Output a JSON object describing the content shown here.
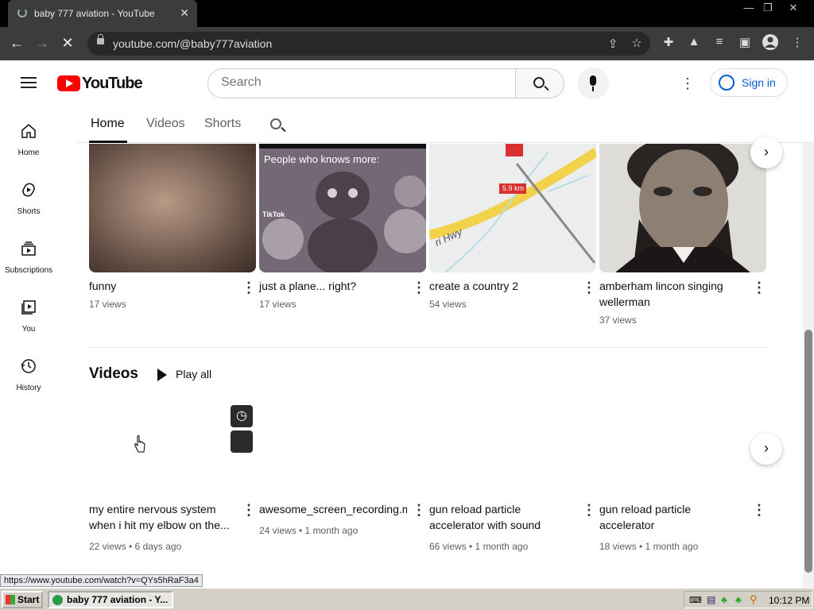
{
  "browser": {
    "tab_title": "baby 777 aviation - YouTube",
    "url": "youtube.com/@baby777aviation",
    "status_url": "https://www.youtube.com/watch?v=QYs5hRaF3a4"
  },
  "header": {
    "logo_text": "YouTube",
    "search_placeholder": "Search",
    "signin_label": "Sign in"
  },
  "sidebar": {
    "items": [
      {
        "label": "Home"
      },
      {
        "label": "Shorts"
      },
      {
        "label": "Subscriptions"
      },
      {
        "label": "You"
      },
      {
        "label": "History"
      }
    ]
  },
  "channel_tabs": [
    {
      "label": "Home"
    },
    {
      "label": "Videos"
    },
    {
      "label": "Shorts"
    }
  ],
  "shorts": [
    {
      "title": "funny",
      "views": "17 views"
    },
    {
      "title": "just a plane... right?",
      "views": "17 views",
      "overlay_text": "People who knows more:",
      "watermark": "TikTok"
    },
    {
      "title": "create a country 2",
      "views": "54 views",
      "map_label": "5.9 km",
      "road_label": "ri Hwy"
    },
    {
      "title": "amberham lincon singing wellerman",
      "views": "37 views"
    }
  ],
  "videos_section": {
    "heading": "Videos",
    "play_all": "Play all",
    "items": [
      {
        "title_line1": "my entire nervous system",
        "title_line2": "when i hit my elbow on the...",
        "meta": "22 views • 6 days ago"
      },
      {
        "title_line1": "awesome_screen_recording.m",
        "title_line2": "",
        "meta": "24 views • 1 month ago"
      },
      {
        "title_line1": "gun reload particle",
        "title_line2": "accelerator with sound",
        "meta": "66 views • 1 month ago"
      },
      {
        "title_line1": "gun reload particle",
        "title_line2": "accelerator",
        "meta": "18 views • 1 month ago"
      }
    ]
  },
  "taskbar": {
    "start_label": "Start",
    "task_label": "baby 777 aviation - Y...",
    "clock": "10:12 PM"
  }
}
